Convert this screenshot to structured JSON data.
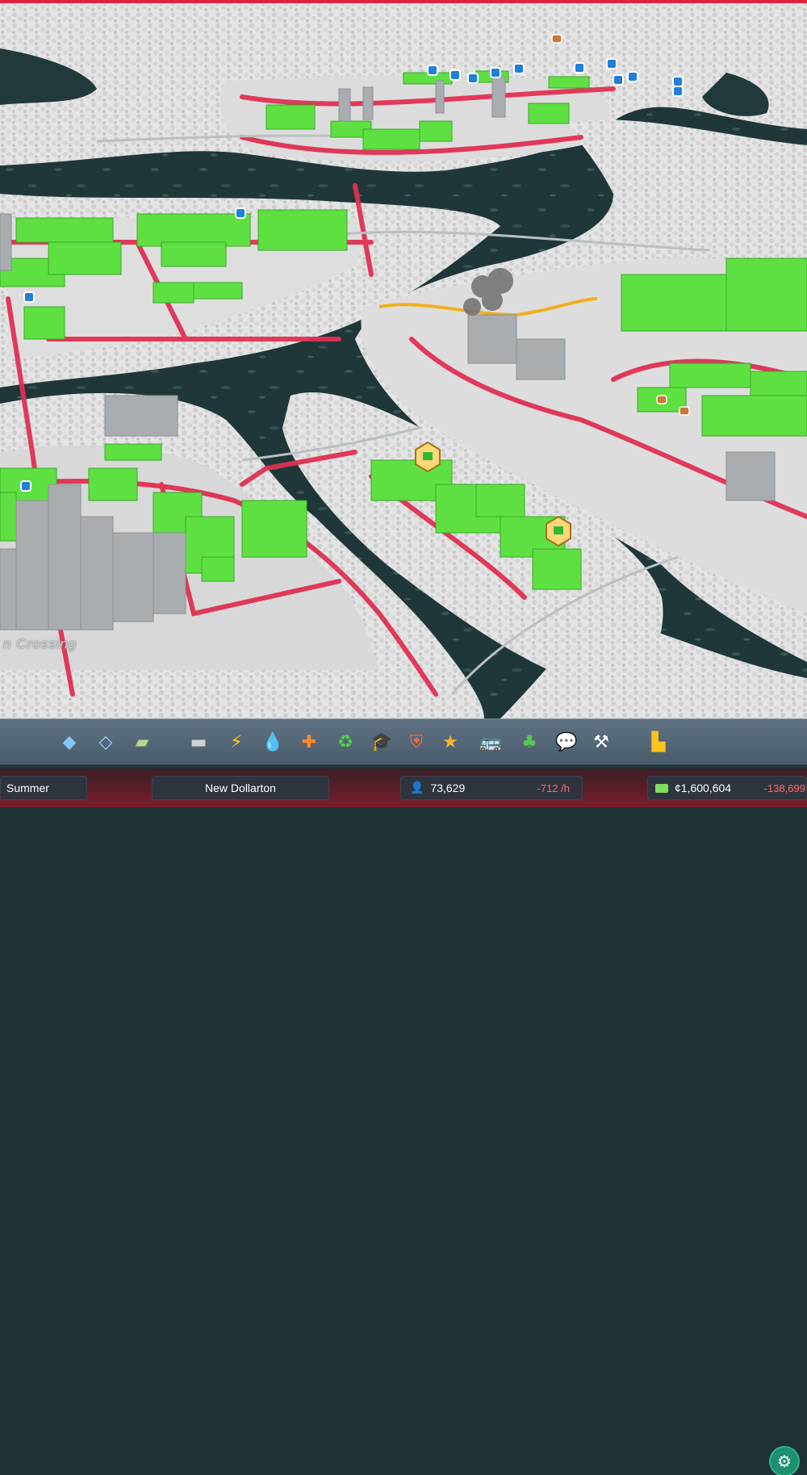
{
  "map": {
    "district_label": "n Crossing"
  },
  "toolbar": {
    "tools": [
      {
        "name": "zoning-icon",
        "glyph": "◆",
        "color": "#7ec8ff"
      },
      {
        "name": "areas-icon",
        "glyph": "◇",
        "color": "#9fd6ff"
      },
      {
        "name": "landscaping-icon",
        "glyph": "▰",
        "color": "#b6d48a"
      },
      {
        "name": "roads-icon",
        "glyph": "▬",
        "color": "#cfd3d6"
      },
      {
        "name": "electricity-icon",
        "glyph": "⚡",
        "color": "#ffcc1a"
      },
      {
        "name": "water-icon",
        "glyph": "💧",
        "color": "#3aa8ff"
      },
      {
        "name": "healthcare-icon",
        "glyph": "✚",
        "color": "#ff8a2a"
      },
      {
        "name": "garbage-icon",
        "glyph": "♻",
        "color": "#4fd04f"
      },
      {
        "name": "education-icon",
        "glyph": "🎓",
        "color": "#8fa7c4"
      },
      {
        "name": "fire-icon",
        "glyph": "⛨",
        "color": "#ff6a3a"
      },
      {
        "name": "police-icon",
        "glyph": "★",
        "color": "#f5b72a"
      },
      {
        "name": "transport-icon",
        "glyph": "🚌",
        "color": "#3bd08a"
      },
      {
        "name": "parks-icon",
        "glyph": "♣",
        "color": "#57c857"
      },
      {
        "name": "communications-icon",
        "glyph": "💬",
        "color": "#e6edf2"
      },
      {
        "name": "landscape-tool-icon",
        "glyph": "⚒",
        "color": "#ffffff"
      },
      {
        "name": "bulldozer-icon",
        "glyph": "▙",
        "color": "#ffc21a"
      }
    ],
    "settings_glyph": "⚙"
  },
  "status": {
    "season": "Summer",
    "city_name": "New Dollarton",
    "population": "73,629",
    "population_change": "-712 /h",
    "money": "¢1,600,604",
    "money_change": "-138,699"
  }
}
